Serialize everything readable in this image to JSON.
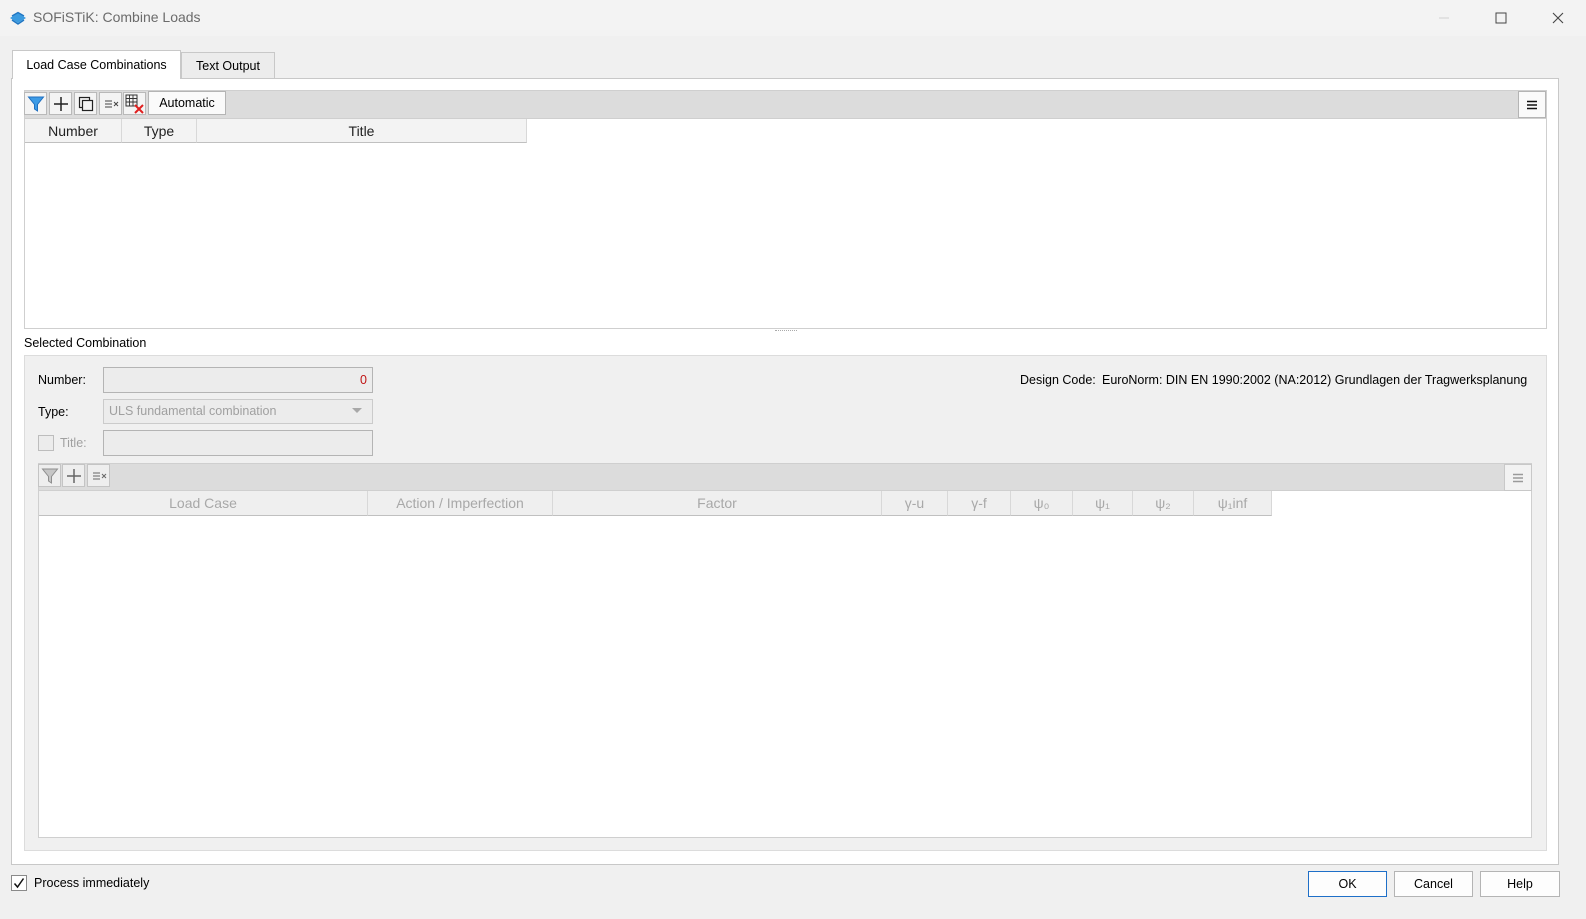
{
  "window": {
    "title": "SOFiSTiK: Combine Loads",
    "icons": [
      "minimize-icon",
      "maximize-icon",
      "close-icon"
    ]
  },
  "tabs": [
    {
      "label": "Load Case Combinations",
      "active": true
    },
    {
      "label": "Text Output",
      "active": false
    }
  ],
  "top_toolbar": {
    "automatic_label": "Automatic",
    "icons": [
      "filter-icon",
      "add-icon",
      "copy-icon",
      "clear-icon",
      "delete-table-icon",
      "hamburger-menu-icon"
    ]
  },
  "combos_table": {
    "columns": [
      "Number",
      "Type",
      "Title"
    ],
    "rows": []
  },
  "selected": {
    "section_label": "Selected Combination",
    "number_label": "Number:",
    "number_value": "0",
    "type_label": "Type:",
    "type_value": "ULS fundamental combination",
    "title_label": "Title:",
    "title_value": "",
    "design_code_label": "Design Code:",
    "design_code_value": "EuroNorm: DIN EN 1990:2002 (NA:2012) Grundlagen der Tragwerksplanung"
  },
  "loadcase_table": {
    "columns": [
      "Load Case",
      "Action / Imperfection",
      "Factor",
      "γ-u",
      "γ-f",
      "ψ₀",
      "ψ₁",
      "ψ₂",
      "ψ₁inf"
    ],
    "rows": []
  },
  "footer": {
    "process_label": "Process immediately",
    "process_checked": true,
    "ok_label": "OK",
    "cancel_label": "Cancel",
    "help_label": "Help"
  },
  "colors": {
    "accent": "#1e6fc8",
    "number_value": "#c01414",
    "filter_active": "#2b8ee0",
    "delete_red": "#e02020"
  }
}
